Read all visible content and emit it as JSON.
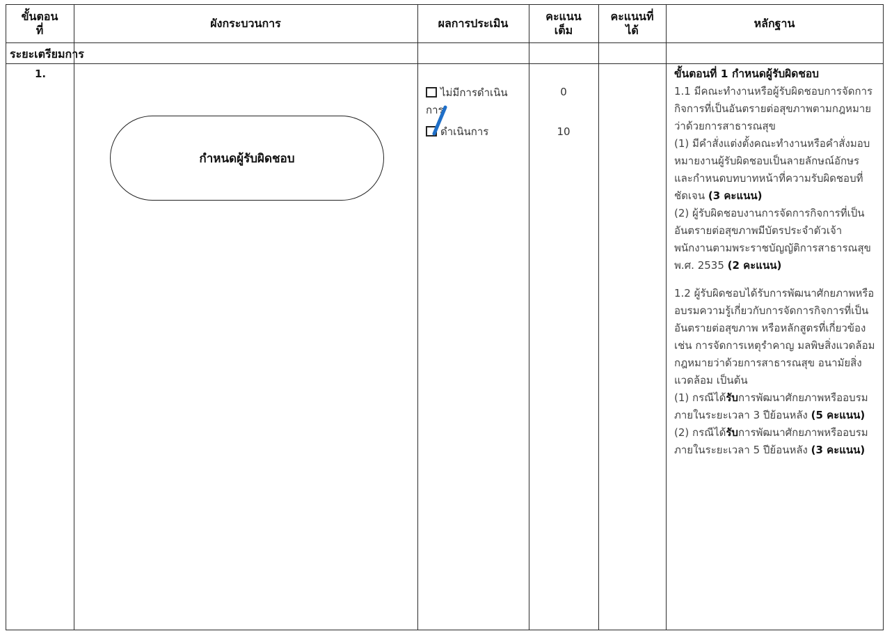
{
  "headers": {
    "step": "ขั้นตอนที่",
    "flow": "ผังกระบวนการ",
    "result": "ผลการประเมิน",
    "full_score": "คะแนนเต็ม",
    "got_score": "คะแนนที่ได้",
    "evidence": "หลักฐาน"
  },
  "phase_label": "ระยะเตรียมการ",
  "step": {
    "number": "1.",
    "flow_box": "กำหนดผู้รับผิดชอบ",
    "options": [
      {
        "label": "ไม่มีการดำเนินการ",
        "checked": false,
        "score": "0"
      },
      {
        "label": "ดำเนินการ",
        "checked": true,
        "score": "10"
      }
    ],
    "evidence": {
      "title": "ขั้นตอนที่ 1 กำหนดผู้รับผิดชอบ",
      "s11": "1.1 มีคณะทำงานหรือผู้รับผิดชอบการจัดการกิจการที่เป็นอันตรายต่อสุขภาพตามกฎหมายว่าด้วยการสาธารณสุข",
      "s11_1": "(1) มีคำสั่งแต่งตั้งคณะทำงานหรือคำสั่งมอบหมายงานผู้รับผิดชอบเป็นลายลักษณ์อักษร และกำหนดบทบาทหน้าที่ความรับผิดชอบที่ชัดเจน",
      "s11_1_pts": "(3 คะแนน)",
      "s11_2": "(2) ผู้รับผิดชอบงานการจัดการกิจการที่เป็นอันตรายต่อสุขภาพมีบัตรประจำตัวเจ้าพนักงานตามพระราชบัญญัติการสาธารณสุข พ.ศ. 2535",
      "s11_2_pts": "(2 คะแนน)",
      "s12": "1.2 ผู้รับผิดชอบได้รับการพัฒนาศักยภาพหรืออบรมความรู้เกี่ยวกับการจัดการกิจการที่เป็นอันตรายต่อสุขภาพ หรือหลักสูตรที่เกี่ยวข้อง เช่น การจัดการเหตุรำคาญ มลพิษสิ่งแวดล้อม กฎหมายว่าด้วยการสาธารณสุข อนามัยสิ่งแวดล้อม เป็นต้น",
      "s12_1_pre": "(1) กรณีได้",
      "s12_1_bold": "รับ",
      "s12_1_post": "การพัฒนาศักยภาพหรืออบรมภายในระยะเวลา 3 ปีย้อนหลัง",
      "s12_1_pts": "(5 คะแนน)",
      "s12_2_pre": "(2) กรณีได้",
      "s12_2_bold": "รับ",
      "s12_2_post": "การพัฒนาศักยภาพหรืออบรมภายในระยะเวลา 5 ปีย้อนหลัง",
      "s12_2_pts": "(3 คะแนน)"
    }
  },
  "colors": {
    "tick": "#1f6fc8",
    "border": "#2b2b2b"
  }
}
